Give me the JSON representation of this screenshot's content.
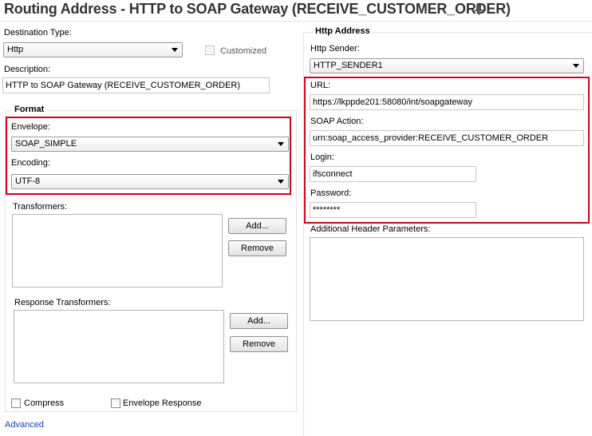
{
  "header": {
    "title": "Routing Address - HTTP to SOAP Gateway (RECEIVE_CUSTOMER_ORDER)"
  },
  "left": {
    "destination_type_label": "Destination Type:",
    "destination_type_value": "Http",
    "customized_label": "Customized",
    "description_label": "Description:",
    "description_value": "HTTP to SOAP Gateway (RECEIVE_CUSTOMER_ORDER)",
    "format": {
      "legend": "Format",
      "envelope_label": "Envelope:",
      "envelope_value": "SOAP_SIMPLE",
      "encoding_label": "Encoding:",
      "encoding_value": "UTF-8",
      "transformers_label": "Transformers:",
      "response_transformers_label": "Response Transformers:",
      "add_label": "Add...",
      "remove_label": "Remove",
      "compress_label": "Compress",
      "envelope_response_label": "Envelope Response"
    },
    "advanced_link": "Advanced"
  },
  "right": {
    "legend": "Http Address",
    "http_sender_label": "Http Sender:",
    "http_sender_value": "HTTP_SENDER1",
    "url_label": "URL:",
    "url_value": "https://lkppde201:58080/int/soapgateway",
    "soap_action_label": "SOAP Action:",
    "soap_action_value": "urn:soap_access_provider:RECEIVE_CUSTOMER_ORDER",
    "login_label": "Login:",
    "login_value": "ifsconnect",
    "password_label": "Password:",
    "password_value": "********",
    "additional_header_label": "Additional Header Parameters:"
  },
  "colors": {
    "highlight_red": "#d9001b",
    "link_blue": "#1a3fbf"
  }
}
